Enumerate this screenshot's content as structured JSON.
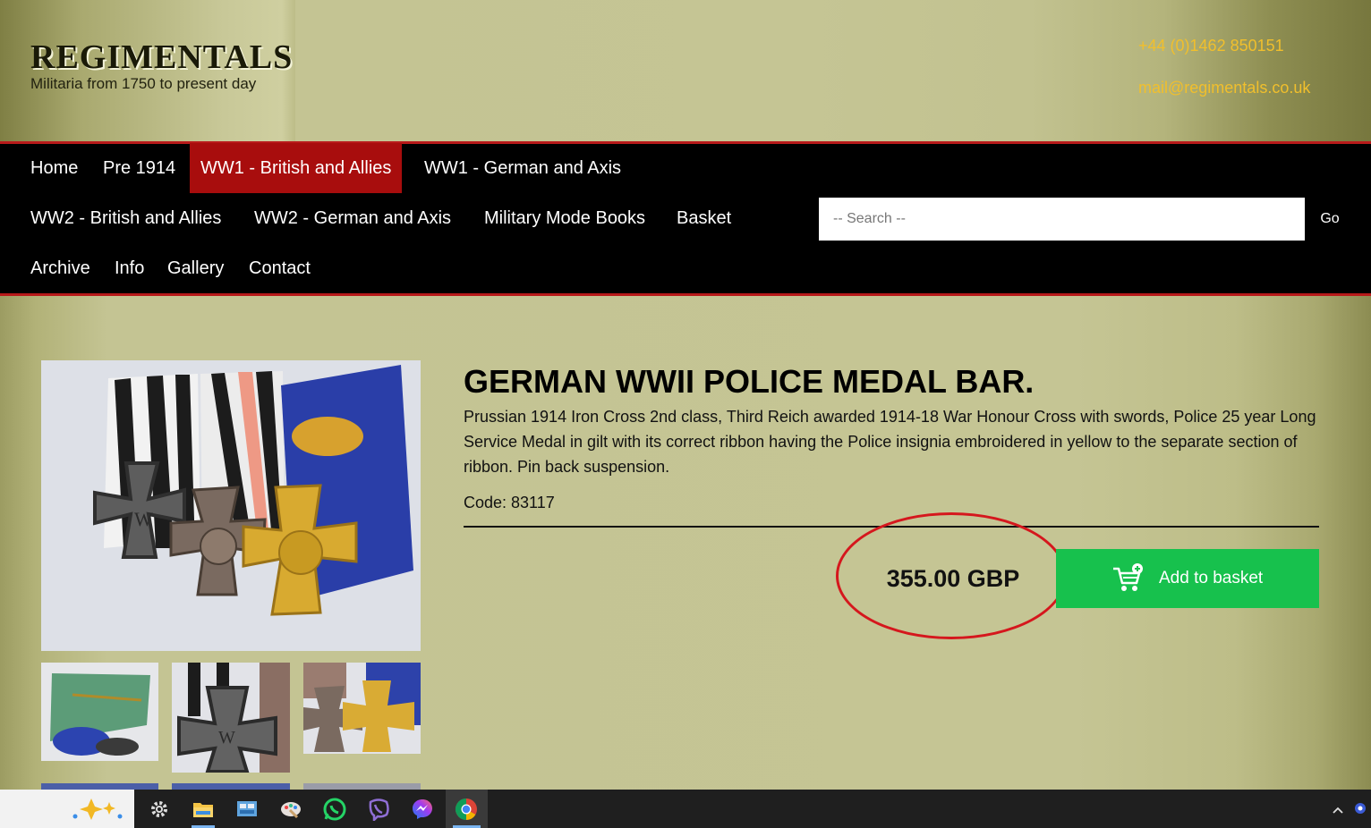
{
  "header": {
    "logo_title": "REGIMENTALS",
    "logo_subtitle": "Militaria from 1750 to present day",
    "phone": "+44 (0)1462 850151",
    "email": "mail@regimentals.co.uk"
  },
  "nav": {
    "items": [
      {
        "label": "Home"
      },
      {
        "label": "Pre 1914"
      },
      {
        "label": "WW1 - British and Allies",
        "active": true
      },
      {
        "label": "WW1 - German and Axis"
      },
      {
        "label": "WW2 - British and Allies"
      },
      {
        "label": "WW2 - German and Axis"
      },
      {
        "label": "Military Mode Books"
      },
      {
        "label": "Basket"
      },
      {
        "label": "Archive"
      },
      {
        "label": "Info"
      },
      {
        "label": "Gallery"
      },
      {
        "label": "Contact"
      }
    ],
    "search_placeholder": "-- Search --",
    "search_button": "Go"
  },
  "product": {
    "title": "GERMAN WWII POLICE MEDAL BAR.",
    "description": "Prussian 1914 Iron Cross 2nd class, Third Reich awarded 1914-18 War Honour Cross with swords, Police 25 year Long Service Medal in gilt with its correct ribbon having the Police insignia embroidered in yellow to the separate section of ribbon. Pin back suspension.",
    "code": "Code: 83117",
    "price": "355.00 GBP",
    "add_to_basket": "Add to basket"
  },
  "colors": {
    "nav_active": "#a80d0d",
    "nav_border": "#b81a1a",
    "contact_text": "#f1bf2c",
    "basket_button": "#17c14d",
    "annotation_circle": "#d5171d"
  },
  "taskbar": {
    "icons": [
      "copilot-icon",
      "settings-icon",
      "file-explorer-icon",
      "control-panel-icon",
      "paint-icon",
      "whatsapp-icon",
      "viber-icon",
      "messenger-icon",
      "chrome-icon"
    ]
  }
}
